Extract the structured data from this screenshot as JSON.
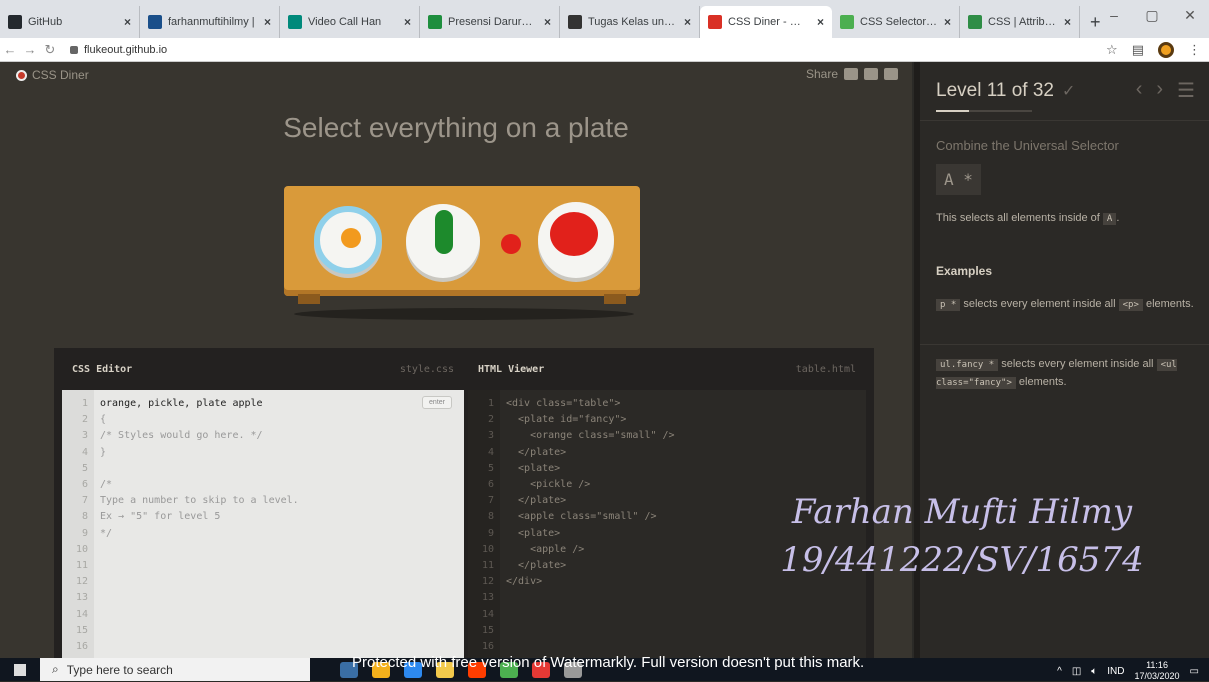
{
  "browser": {
    "tabs": [
      {
        "title": "GitHub",
        "icon": "github-icon",
        "color": "#24292e"
      },
      {
        "title": "farhanmuftihilmy |",
        "icon": "profile-icon",
        "color": "#1a4f8a"
      },
      {
        "title": "Video Call Han",
        "icon": "meet-icon",
        "color": "#00897b"
      },
      {
        "title": "Presensi Darurat T",
        "icon": "sheets-icon",
        "color": "#1e8e3e"
      },
      {
        "title": "Tugas Kelas untuk",
        "icon": "classroom-icon",
        "color": "#333"
      },
      {
        "title": "CSS Diner - Where",
        "icon": "diner-icon",
        "color": "#d93025",
        "active": true
      },
      {
        "title": "CSS Selectors Refe",
        "icon": "w3-icon",
        "color": "#4caf50"
      },
      {
        "title": "CSS | Attribute Sel",
        "icon": "gfg-icon",
        "color": "#2f8d46"
      }
    ],
    "url": "flukeout.github.io"
  },
  "game": {
    "logo": "CSS Diner",
    "share_label": "Share",
    "instruction": "Select everything on a plate"
  },
  "editor": {
    "css_title": "CSS Editor",
    "css_file": "style.css",
    "html_title": "HTML Viewer",
    "html_file": "table.html",
    "enter_label": "enter",
    "css_input": "orange, pickle, plate apple",
    "css_lines": [
      "{",
      "/* Styles would go here. */",
      "}",
      "",
      "/*",
      "Type a number to skip to a level.",
      "Ex → \"5\" for level 5",
      "*/",
      "",
      "",
      "",
      "",
      "",
      "",
      ""
    ],
    "html_lines": [
      "<div class=\"table\">",
      "  <plate id=\"fancy\">",
      "    <orange class=\"small\" />",
      "  </plate>",
      "  <plate>",
      "    <pickle />",
      "  </plate>",
      "  <apple class=\"small\" />",
      "  <plate>",
      "    <apple />",
      "  </plate>",
      "</div>",
      "",
      "",
      "",
      ""
    ]
  },
  "watermark": {
    "name": "Farhan Mufti Hilmy",
    "id": "19/441222/SV/16574",
    "notice": "Protected with free version of Watermarkly. Full version doesn't put this mark."
  },
  "sidebar": {
    "level_text": "Level 11 of 32",
    "progress": 0.34,
    "title": "Combine the Universal Selector",
    "syntax": "A  *",
    "desc_prefix": "This selects all elements inside of",
    "desc_tag": "A",
    "examples_heading": "Examples",
    "ex1_tag": "p *",
    "ex1_text": "selects every element inside all",
    "ex1_tag2": "<p>",
    "ex1_tail": "elements.",
    "ex2_tag": "ul.fancy *",
    "ex2_text": "selects every element inside all",
    "ex2_tag2": "<ul class=\"fancy\">",
    "ex2_tail": "elements."
  },
  "taskbar": {
    "search_placeholder": "Type here to search",
    "lang": "IND",
    "time": "11:16",
    "date": "17/03/2020"
  }
}
